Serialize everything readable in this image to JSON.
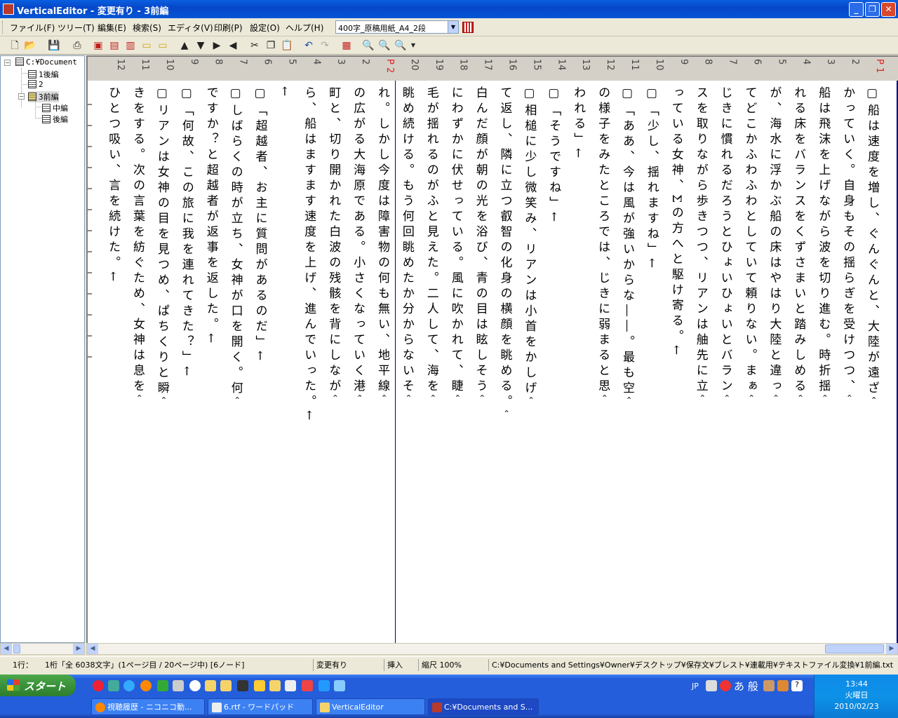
{
  "window": {
    "title": "VerticalEditor - 変更有り - 3前編",
    "buttons": [
      "_",
      "❐",
      "✕"
    ]
  },
  "menu": {
    "items": [
      "ファイル(F)",
      "ツリー(T)",
      "編集(E)",
      "検索(S)",
      "エディタ(V)",
      "印刷(P)",
      "設定(O)",
      "ヘルプ(H)"
    ],
    "paper_select_value": "400字_原稿用紙_A4_2段"
  },
  "tree": {
    "nodes": [
      "C:¥Document",
      "1後編",
      "2",
      "3前編",
      "中編",
      "後編"
    ]
  },
  "editor": {
    "page_labels": [
      "P 1",
      "P 2"
    ],
    "right_columns": [
      {
        "num": "1",
        "text": "▢船は速度を増し、ぐんぐんと、大陸が遠ざ＾",
        "box": true,
        "num_red": true,
        "num_label": "P 1"
      },
      {
        "num": "2",
        "text": "かっていく。自身もその揺らぎを受けつつ、＾"
      },
      {
        "num": "3",
        "text": "船は飛沫を上げながら波を切り進む。時折揺＾"
      },
      {
        "num": "4",
        "text": "れる床をバランスをくずさまいと踏みしめる＾"
      },
      {
        "num": "5",
        "text": "が、海水に浮かぶ船の床はやはり大陸と違っ＾"
      },
      {
        "num": "6",
        "text": "てどこかふわふわとしていて頼りない。まぁ＾"
      },
      {
        "num": "7",
        "text": "じきに慣れるだろうとひょいひょいとバラン＾"
      },
      {
        "num": "8",
        "text": "スを取りながら歩きつつ、リアンは舳先に立＾"
      },
      {
        "num": "9",
        "text": "っている女神、Σの方へと駆け寄る。←"
      },
      {
        "num": "10",
        "text": "▢「少し、揺れますね」←"
      },
      {
        "num": "11",
        "text": "▢「ああ、今は風が強いからな――。最も空＾"
      },
      {
        "num": "12",
        "text": "の様子をみたところでは、じきに弱まると思＾"
      },
      {
        "num": "13",
        "text": "われる」←"
      },
      {
        "num": "14",
        "text": "▢「そうですね」←"
      },
      {
        "num": "15",
        "text": "▢相槌に少し微笑み、リアンは小首をかしげ＾"
      },
      {
        "num": "16",
        "text": "て返し、隣に立つ叡智の化身の横顔を眺める。＾"
      },
      {
        "num": "17",
        "text": "白んだ顔が朝の光を浴び、青の目は眩しそう＾"
      },
      {
        "num": "18",
        "text": "にわずかに伏せっている。風に吹かれて、睫＾"
      },
      {
        "num": "19",
        "text": "毛が揺れるのがふと見えた。二人して、海を＾"
      },
      {
        "num": "20",
        "text": "眺め続ける。もう何回眺めたか分からないそ＾"
      }
    ],
    "left_columns": [
      {
        "num": "1",
        "text": "れ。しかし今度は障害物の何も無い、地平線＾",
        "num_label": "P 2"
      },
      {
        "num": "2",
        "text": "の広がる大海原である。小さくなっていく港＾"
      },
      {
        "num": "3",
        "text": "町と、切り開かれた白波の残骸を背にしなが＾"
      },
      {
        "num": "4",
        "text": "ら、船はますます速度を上げ、進んでいった。←"
      },
      {
        "num": "5",
        "text": "←"
      },
      {
        "num": "6",
        "text": "▢「超越者、お主に質問があるのだ」←"
      },
      {
        "num": "7",
        "text": "▢しばらくの時が立ち、女神が口を開く。何＾"
      },
      {
        "num": "8",
        "text": "ですか？と超越者が返事を返した。←"
      },
      {
        "num": "9",
        "text": "▢「何故、この旅に我を連れてきた？」←"
      },
      {
        "num": "10",
        "text": "▢リアンは女神の目を見つめ、ぱちくりと瞬＾"
      },
      {
        "num": "11",
        "text": "きをする。次の言葉を紡ぐため、女神は息を＾"
      },
      {
        "num": "12",
        "text": "ひとつ吸い、言を続けた。←"
      }
    ]
  },
  "status": {
    "cursor": "1行：",
    "position": "1桁「全 6038文字」(1ページ目 / 20ページ中) [6ノード]",
    "modified": "変更有り",
    "mode": "挿入",
    "zoom": "縮尺 100%",
    "path": "C:¥Documents and Settings¥Owner¥デスクトップ¥保存文¥ブレスト¥連載用¥テキストファイル変換¥1前編.txt"
  },
  "taskbar": {
    "start": "スタート",
    "tasks": [
      "視聴履歴 - ニコニコ動...",
      "6.rtf - ワードパッド",
      "VerticalEditor",
      "C:¥Documents and S..."
    ],
    "ime_lang": "JP",
    "ime_text": "あ 般",
    "clock_time": "13:44",
    "clock_day": "火曜日",
    "clock_date": "2010/02/23"
  }
}
